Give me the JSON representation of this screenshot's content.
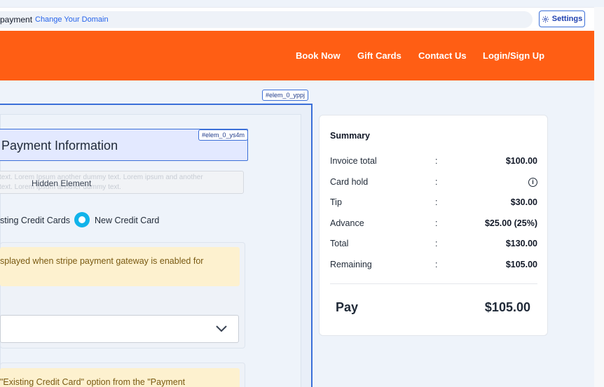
{
  "topbar": {
    "page_name": "payment",
    "domain_link": "Change Your Domain",
    "settings_label": "Settings"
  },
  "nav": {
    "items": [
      "Book Now",
      "Gift Cards",
      "Contact Us",
      "Login/Sign Up"
    ]
  },
  "tags": {
    "outer": "#elem_0_yppj",
    "title": "#elem_0_ys4m"
  },
  "payment": {
    "title": "Payment Information",
    "hidden_bg_text": "text. Lorem Ipsum another dummy text. Lorem ipsum and another",
    "hidden_bg_text2": "text. Lorem Ipsum another dummy text.",
    "hidden_label": "Hidden Element",
    "radio_existing": "sting Credit Cards",
    "radio_new": "New Credit Card",
    "notice_1": "splayed when stripe payment gateway is enabled for",
    "notice_2": "\"Existing Credit Card\" option from the \"Payment"
  },
  "summary": {
    "title": "Summary",
    "rows": [
      {
        "label": "Invoice total",
        "value": "$100.00"
      },
      {
        "label": "Card hold",
        "value": ""
      },
      {
        "label": "Tip",
        "value": "$30.00"
      },
      {
        "label": "Advance",
        "value": "$25.00 (25%)"
      },
      {
        "label": "Total",
        "value": "$130.00"
      },
      {
        "label": "Remaining",
        "value": "$105.00"
      }
    ],
    "colon": ":",
    "info_glyph": "i",
    "pay_label": "Pay",
    "pay_amount": "$105.00"
  },
  "colors": {
    "nav_bg": "#ff5e14",
    "accent": "#3b6fd8",
    "radio": "#11b3ea",
    "notice_bg": "#fdf1cf"
  }
}
